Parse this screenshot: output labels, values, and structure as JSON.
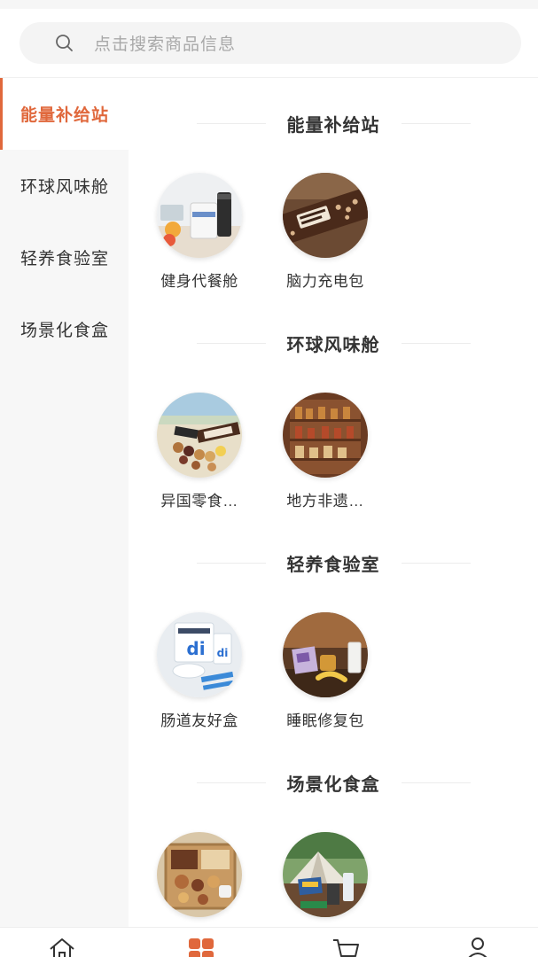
{
  "search": {
    "placeholder": "点击搜索商品信息",
    "icon": "search-icon"
  },
  "sidebar": {
    "items": [
      {
        "label": "能量补给站",
        "active": true
      },
      {
        "label": "环球风味舱",
        "active": false
      },
      {
        "label": "轻养食验室",
        "active": false
      },
      {
        "label": "场景化食盒",
        "active": false
      }
    ]
  },
  "sections": [
    {
      "title": "能量补给站",
      "items": [
        {
          "label": "健身代餐舱"
        },
        {
          "label": "脑力充电包"
        }
      ]
    },
    {
      "title": "环球风味舱",
      "items": [
        {
          "label": "异国零食…"
        },
        {
          "label": "地方非遗…"
        }
      ]
    },
    {
      "title": "轻养食验室",
      "items": [
        {
          "label": "肠道友好盒"
        },
        {
          "label": "睡眠修复包"
        }
      ]
    },
    {
      "title": "场景化食盒",
      "items": [
        {
          "label": ""
        },
        {
          "label": ""
        }
      ]
    }
  ],
  "colors": {
    "accent": "#e0683c",
    "sidebar_bg": "#f7f7f7",
    "text": "#333333"
  },
  "tabbar": {
    "icons": [
      "home-icon",
      "category-icon",
      "cart-icon",
      "user-icon"
    ],
    "active": "category-icon"
  }
}
